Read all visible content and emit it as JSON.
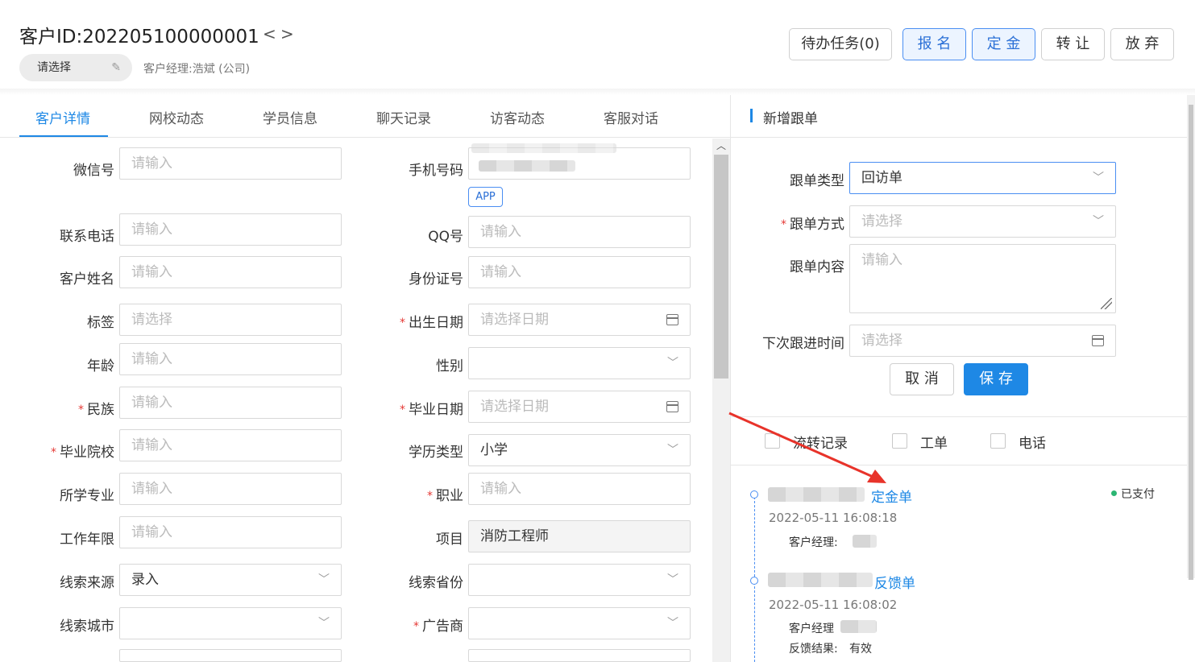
{
  "header": {
    "customer_id": "客户ID:202205100000001",
    "prev_icon": "<",
    "next_icon": ">",
    "owner_select": "请选择",
    "manager_info": "客户经理:浩斌 (公司)",
    "buttons": {
      "todo": "待办任务(0)",
      "signup": "报 名",
      "deposit": "定 金",
      "transfer": "转 让",
      "abandon": "放 弃"
    }
  },
  "tabs": [
    "客户详情",
    "网校动态",
    "学员信息",
    "聊天记录",
    "访客动态",
    "客服对话"
  ],
  "active_tab": "客户详情",
  "form": {
    "wechat": {
      "label": "微信号",
      "placeholder": "请输入"
    },
    "phone": {
      "label": "手机号码",
      "tag": "APP"
    },
    "contact_phone": {
      "label": "联系电话",
      "placeholder": "请输入"
    },
    "qq": {
      "label": "QQ号",
      "placeholder": "请输入"
    },
    "name": {
      "label": "客户姓名",
      "placeholder": "请输入"
    },
    "id_card": {
      "label": "身份证号",
      "placeholder": "请输入"
    },
    "tags": {
      "label": "标签",
      "placeholder": "请选择"
    },
    "birthday": {
      "label": "出生日期",
      "placeholder": "请选择日期"
    },
    "age": {
      "label": "年龄",
      "placeholder": "请输入"
    },
    "gender": {
      "label": "性别",
      "value": ""
    },
    "ethnicity": {
      "label": "民族",
      "placeholder": "请输入"
    },
    "grad_date": {
      "label": "毕业日期",
      "placeholder": "请选择日期"
    },
    "school": {
      "label": "毕业院校",
      "placeholder": "请输入"
    },
    "edu_type": {
      "label": "学历类型",
      "value": "小学"
    },
    "major": {
      "label": "所学专业",
      "placeholder": "请输入"
    },
    "occupation": {
      "label": "职业",
      "placeholder": "请输入"
    },
    "work_years": {
      "label": "工作年限",
      "placeholder": "请输入"
    },
    "project": {
      "label": "项目",
      "value": "消防工程师"
    },
    "lead_source": {
      "label": "线索来源",
      "value": "录入"
    },
    "lead_province": {
      "label": "线索省份",
      "value": ""
    },
    "lead_city": {
      "label": "线索城市",
      "value": ""
    },
    "advertiser": {
      "label": "广告商",
      "value": ""
    }
  },
  "follow_up": {
    "title": "新增跟单",
    "type": {
      "label": "跟单类型",
      "value": "回访单"
    },
    "method": {
      "label": "跟单方式",
      "placeholder": "请选择"
    },
    "content": {
      "label": "跟单内容",
      "placeholder": "请输入"
    },
    "next_time": {
      "label": "下次跟进时间",
      "placeholder": "请选择"
    },
    "cancel": "取 消",
    "save": "保 存"
  },
  "filters": [
    "流转记录",
    "工单",
    "电话"
  ],
  "timeline": [
    {
      "type": "定金单",
      "time": "2022-05-11 16:08:18",
      "manager_label": "客户经理:",
      "status": "已支付"
    },
    {
      "type": "反馈单",
      "time": "2022-05-11 16:08:02",
      "manager_label": "客户经理",
      "result_label": "反馈结果:",
      "result": "有效"
    }
  ],
  "colors": {
    "accent": "#1e88e5",
    "required": "#e53935",
    "paid": "#2bb673",
    "annotation_arrow": "#e8332a"
  }
}
